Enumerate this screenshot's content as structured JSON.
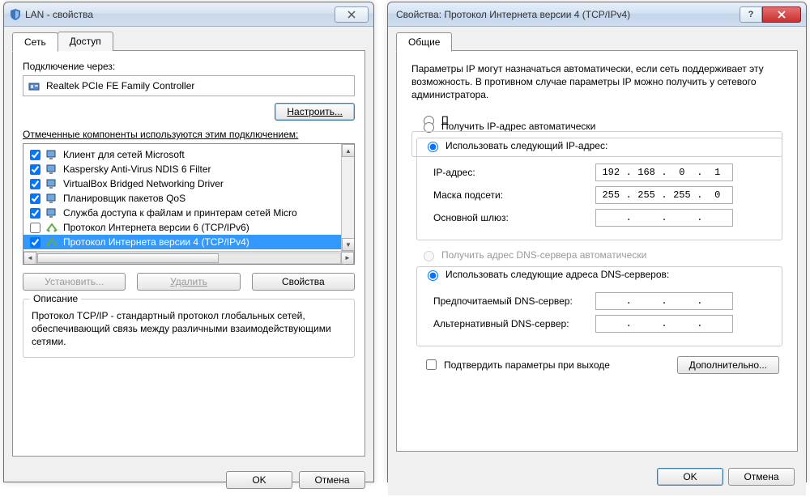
{
  "left": {
    "title": "LAN - свойства",
    "tabs": {
      "network": "Сеть",
      "access": "Доступ"
    },
    "connect_via": "Подключение через:",
    "adapter": "Realtek PCIe FE Family Controller",
    "configure": "Настроить...",
    "components_label": "Отмеченные компоненты используются этим подключением:",
    "items": [
      {
        "checked": true,
        "label": "Клиент для сетей Microsoft"
      },
      {
        "checked": true,
        "label": "Kaspersky Anti-Virus NDIS 6 Filter"
      },
      {
        "checked": true,
        "label": "VirtualBox Bridged Networking Driver"
      },
      {
        "checked": true,
        "label": "Планировщик пакетов QoS"
      },
      {
        "checked": true,
        "label": "Служба доступа к файлам и принтерам сетей Micro"
      },
      {
        "checked": false,
        "label": "Протокол Интернета версии 6 (TCP/IPv6)"
      },
      {
        "checked": true,
        "label": "Протокол Интернета версии 4 (TCP/IPv4)",
        "selected": true
      }
    ],
    "install": "Установить...",
    "uninstall": "Удалить",
    "properties": "Свойства",
    "desc_legend": "Описание",
    "desc_text": "Протокол TCP/IP - стандартный протокол глобальных сетей, обеспечивающий связь между различными взаимодействующими сетями.",
    "ok": "OK",
    "cancel": "Отмена"
  },
  "right": {
    "title": "Свойства: Протокол Интернета версии 4 (TCP/IPv4)",
    "tab_general": "Общие",
    "para": "Параметры IP могут назначаться автоматически, если сеть поддерживает эту возможность. В противном случае параметры IP можно получить у сетевого администратора.",
    "auto_ip": "Получить IP-адрес автоматически",
    "manual_ip": "Использовать следующий IP-адрес:",
    "ip_label": "IP-адрес:",
    "ip_value": [
      "192",
      "168",
      "0",
      "1"
    ],
    "mask_label": "Маска подсети:",
    "mask_value": [
      "255",
      "255",
      "255",
      "0"
    ],
    "gw_label": "Основной шлюз:",
    "gw_value": [
      "",
      "",
      "",
      ""
    ],
    "auto_dns": "Получить адрес DNS-сервера автоматически",
    "manual_dns": "Использовать следующие адреса DNS-серверов:",
    "pref_dns": "Предпочитаемый DNS-сервер:",
    "pref_dns_value": [
      "",
      "",
      "",
      ""
    ],
    "alt_dns": "Альтернативный DNS-сервер:",
    "alt_dns_value": [
      "",
      "",
      "",
      ""
    ],
    "confirm_exit": "Подтвердить параметры при выходе",
    "advanced": "Дополнительно...",
    "ok": "OK",
    "cancel": "Отмена"
  }
}
